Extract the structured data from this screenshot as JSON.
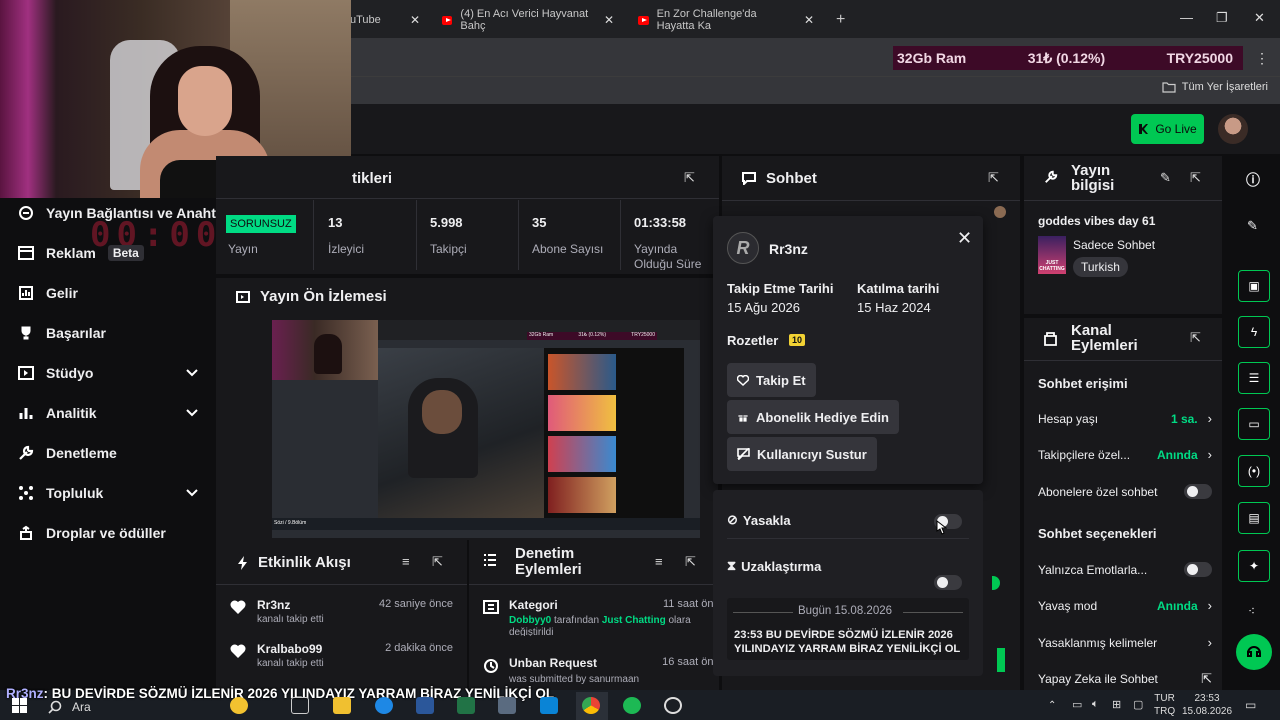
{
  "browser": {
    "tabs": [
      {
        "label": "uTube"
      },
      {
        "label": "(4) En Acı Verici Hayvanat Bahç"
      },
      {
        "label": "En Zor Challenge'da Hayatta Ka"
      }
    ],
    "new_tab": "+",
    "bookmarks_all": "Tüm Yer İşaretleri"
  },
  "ticker": {
    "ram": "32Gb Ram",
    "change": "31₺ (0.12%)",
    "price": "TRY25000"
  },
  "topbar": {
    "golive": "Go Live"
  },
  "timer_overlay": "00:00",
  "sidebar": {
    "items": [
      {
        "label": "Yayın Bağlantısı ve Anahta"
      },
      {
        "label": "Reklam",
        "badge": "Beta"
      },
      {
        "label": "Gelir"
      },
      {
        "label": "Başarılar"
      },
      {
        "label": "Stüdyo",
        "chevron": "⌄"
      },
      {
        "label": "Analitik",
        "chevron": "⌄"
      },
      {
        "label": "Denetleme"
      },
      {
        "label": "Topluluk",
        "chevron": "⌄"
      },
      {
        "label": "Droplar ve ödüller"
      }
    ]
  },
  "stats": {
    "title": "tikleri",
    "status_badge": "SORUNSUZ",
    "items": [
      {
        "value": "",
        "label": "Yayın"
      },
      {
        "value": "13",
        "label": "İzleyici"
      },
      {
        "value": "5.998",
        "label": "Takipçi"
      },
      {
        "value": "35",
        "label": "Abone Sayısı"
      },
      {
        "value": "01:33:58",
        "label": "Yayında Olduğu Süre"
      }
    ]
  },
  "preview": {
    "title": "Yayın Ön İzlemesi",
    "inner": {
      "ram": "32Gb Ram",
      "change": "31₺ (0.12%)",
      "price": "TRY25000",
      "caption": "Sözi / 9.Bölüm"
    }
  },
  "activity": {
    "title": "Etkinlik Akışı",
    "items": [
      {
        "user": "Rr3nz",
        "time": "42 saniye önce",
        "desc": "kanalı takip etti"
      },
      {
        "user": "Kralbabo99",
        "time": "2 dakika önce",
        "desc": "kanalı takip etti"
      }
    ]
  },
  "modactions": {
    "title_line1": "Denetim",
    "title_line2": "Eylemleri",
    "items": [
      {
        "title": "Kategori",
        "time": "11 saat önc",
        "actor": "Dobbyy0",
        "mid": " tarafından ",
        "target": "Just Chatting",
        "rest": " olara",
        "line2": "değiştirildi"
      },
      {
        "title": "Unban Request",
        "time": "16 saat önc",
        "line2": "was submitted by sanurmaan"
      }
    ]
  },
  "chat": {
    "title": "Sohbet"
  },
  "usercard": {
    "username": "Rr3nz",
    "follow_label": "Takip Etme Tarihi",
    "follow_date": "15 Ağu 2026",
    "join_label": "Katılma tarihi",
    "join_date": "15 Haz 2024",
    "badges_label": "Rozetler",
    "badge_num": "10",
    "btn_follow": "Takip Et",
    "btn_gift": "Abonelik Hediye Edin",
    "btn_mute": "Kullanıcıyı Sustur"
  },
  "modcard": {
    "ban": "Yasakla",
    "timeout": "Uzaklaştırma",
    "date_header": "Bugün 15.08.2026",
    "message": "23:53 BU DEVİRDE SÖZMÜ İZLENİR 2026 YILINDAYIZ YARRAM BİRAZ YENİLİKÇİ OL"
  },
  "streaminfo": {
    "title_line1": "Yayın",
    "title_line2": "bilgisi",
    "stream_title": "goddes vibes day 61",
    "category": "Sadece Sohbet",
    "tag": "Turkish",
    "cover_text": "JUST CHATTING"
  },
  "channelactions": {
    "title_line1": "Kanal",
    "title_line2": "Eylemleri",
    "section1": "Sohbet erişimi",
    "rows1": [
      {
        "label": "Hesap yaşı",
        "value": "1 sa."
      },
      {
        "label": "Takipçilere özel...",
        "value": "Anında"
      },
      {
        "label": "Abonelere özel sohbet"
      }
    ],
    "section2": "Sohbet seçenekleri",
    "rows2": [
      {
        "label": "Yalnızca Emotlarla..."
      },
      {
        "label": "Yavaş mod",
        "value": "Anında"
      },
      {
        "label": "Yasaklanmış kelimeler"
      },
      {
        "label": "Yapay Zeka ile Sohbet"
      }
    ]
  },
  "subtitle": {
    "user": "Rr3nz",
    "text": ": BU DEVİRDE SÖZMÜ İZLENİR 2026 YILINDAYIZ YARRAM BİRAZ YENİLİKÇİ OL"
  },
  "taskbar": {
    "search_placeholder": "Ara",
    "lang_line1": "TUR",
    "lang_line2": "TRQ",
    "time": "23:53",
    "date": "15.08.2026"
  },
  "colors": {
    "accent": "#00c853",
    "panel": "#18181b",
    "bg": "#0e0e10",
    "ticker": "#3d0a27"
  }
}
